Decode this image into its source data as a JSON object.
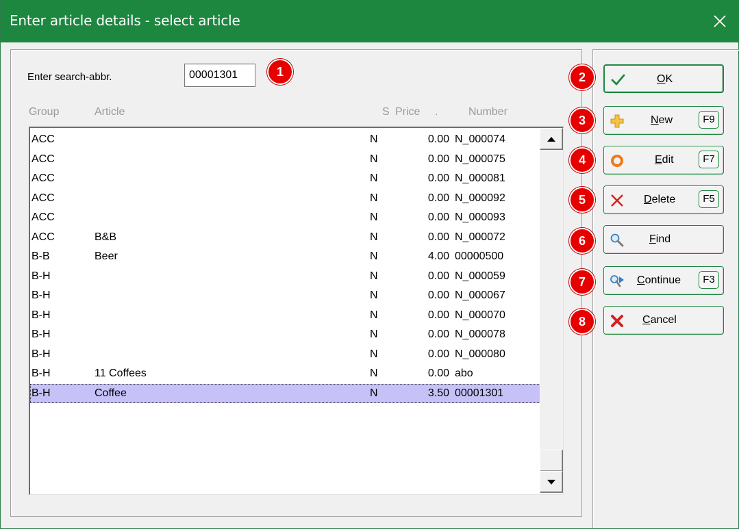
{
  "window": {
    "title": "Enter article details - select article",
    "accent": "#1d8740",
    "close_glyph": "✕"
  },
  "search": {
    "label": "Enter search-abbr.",
    "value": "00001301"
  },
  "columns": {
    "group": "Group",
    "article": "Article",
    "s": "S",
    "price": "Price",
    "dot": ".",
    "number": "Number"
  },
  "rows": [
    {
      "group": "ACC",
      "article": "",
      "s": "N",
      "price": "0.00",
      "number": "N_000074"
    },
    {
      "group": "ACC",
      "article": "",
      "s": "N",
      "price": "0.00",
      "number": "N_000075"
    },
    {
      "group": "ACC",
      "article": "",
      "s": "N",
      "price": "0.00",
      "number": "N_000081"
    },
    {
      "group": "ACC",
      "article": "",
      "s": "N",
      "price": "0.00",
      "number": "N_000092"
    },
    {
      "group": "ACC",
      "article": "",
      "s": "N",
      "price": "0.00",
      "number": "N_000093"
    },
    {
      "group": "ACC",
      "article": "B&B",
      "s": "N",
      "price": "0.00",
      "number": "N_000072"
    },
    {
      "group": "B-B",
      "article": "Beer",
      "s": "N",
      "price": "4.00",
      "number": "00000500"
    },
    {
      "group": "B-H",
      "article": "",
      "s": "N",
      "price": "0.00",
      "number": "N_000059"
    },
    {
      "group": "B-H",
      "article": "",
      "s": "N",
      "price": "0.00",
      "number": "N_000067"
    },
    {
      "group": "B-H",
      "article": "",
      "s": "N",
      "price": "0.00",
      "number": "N_000070"
    },
    {
      "group": "B-H",
      "article": "",
      "s": "N",
      "price": "0.00",
      "number": "N_000078"
    },
    {
      "group": "B-H",
      "article": "",
      "s": "N",
      "price": "0.00",
      "number": "N_000080"
    },
    {
      "group": "B-H",
      "article": "11 Coffees",
      "s": "N",
      "price": "0.00",
      "number": "abo"
    },
    {
      "group": "B-H",
      "article": "Coffee",
      "s": "N",
      "price": "3.50",
      "number": "00001301",
      "selected": true
    }
  ],
  "badges": [
    "1",
    "2",
    "3",
    "4",
    "5",
    "6",
    "7",
    "8"
  ],
  "buttons": {
    "ok": {
      "mnemonic": "O",
      "rest": "K",
      "icon": "checkmark-icon"
    },
    "new": {
      "mnemonic": "N",
      "rest": "ew",
      "key": "F9",
      "icon": "plus-icon"
    },
    "edit": {
      "mnemonic": "E",
      "rest": "dit",
      "key": "F7",
      "icon": "ring-icon"
    },
    "delete": {
      "mnemonic": "D",
      "rest": "elete",
      "key": "F5",
      "icon": "x-icon"
    },
    "find": {
      "mnemonic": "F",
      "rest": "ind",
      "icon": "magnifier-icon"
    },
    "continue": {
      "mnemonic": "C",
      "rest": "ontinue",
      "key": "F3",
      "icon": "magnifier-arrow-icon"
    },
    "cancel": {
      "mnemonic": "C",
      "rest": "ancel",
      "icon": "red-x-icon"
    }
  },
  "colors": {
    "selection": "#c6c2f8",
    "badge": "#e60000",
    "header_text": "#9a9a9a"
  }
}
